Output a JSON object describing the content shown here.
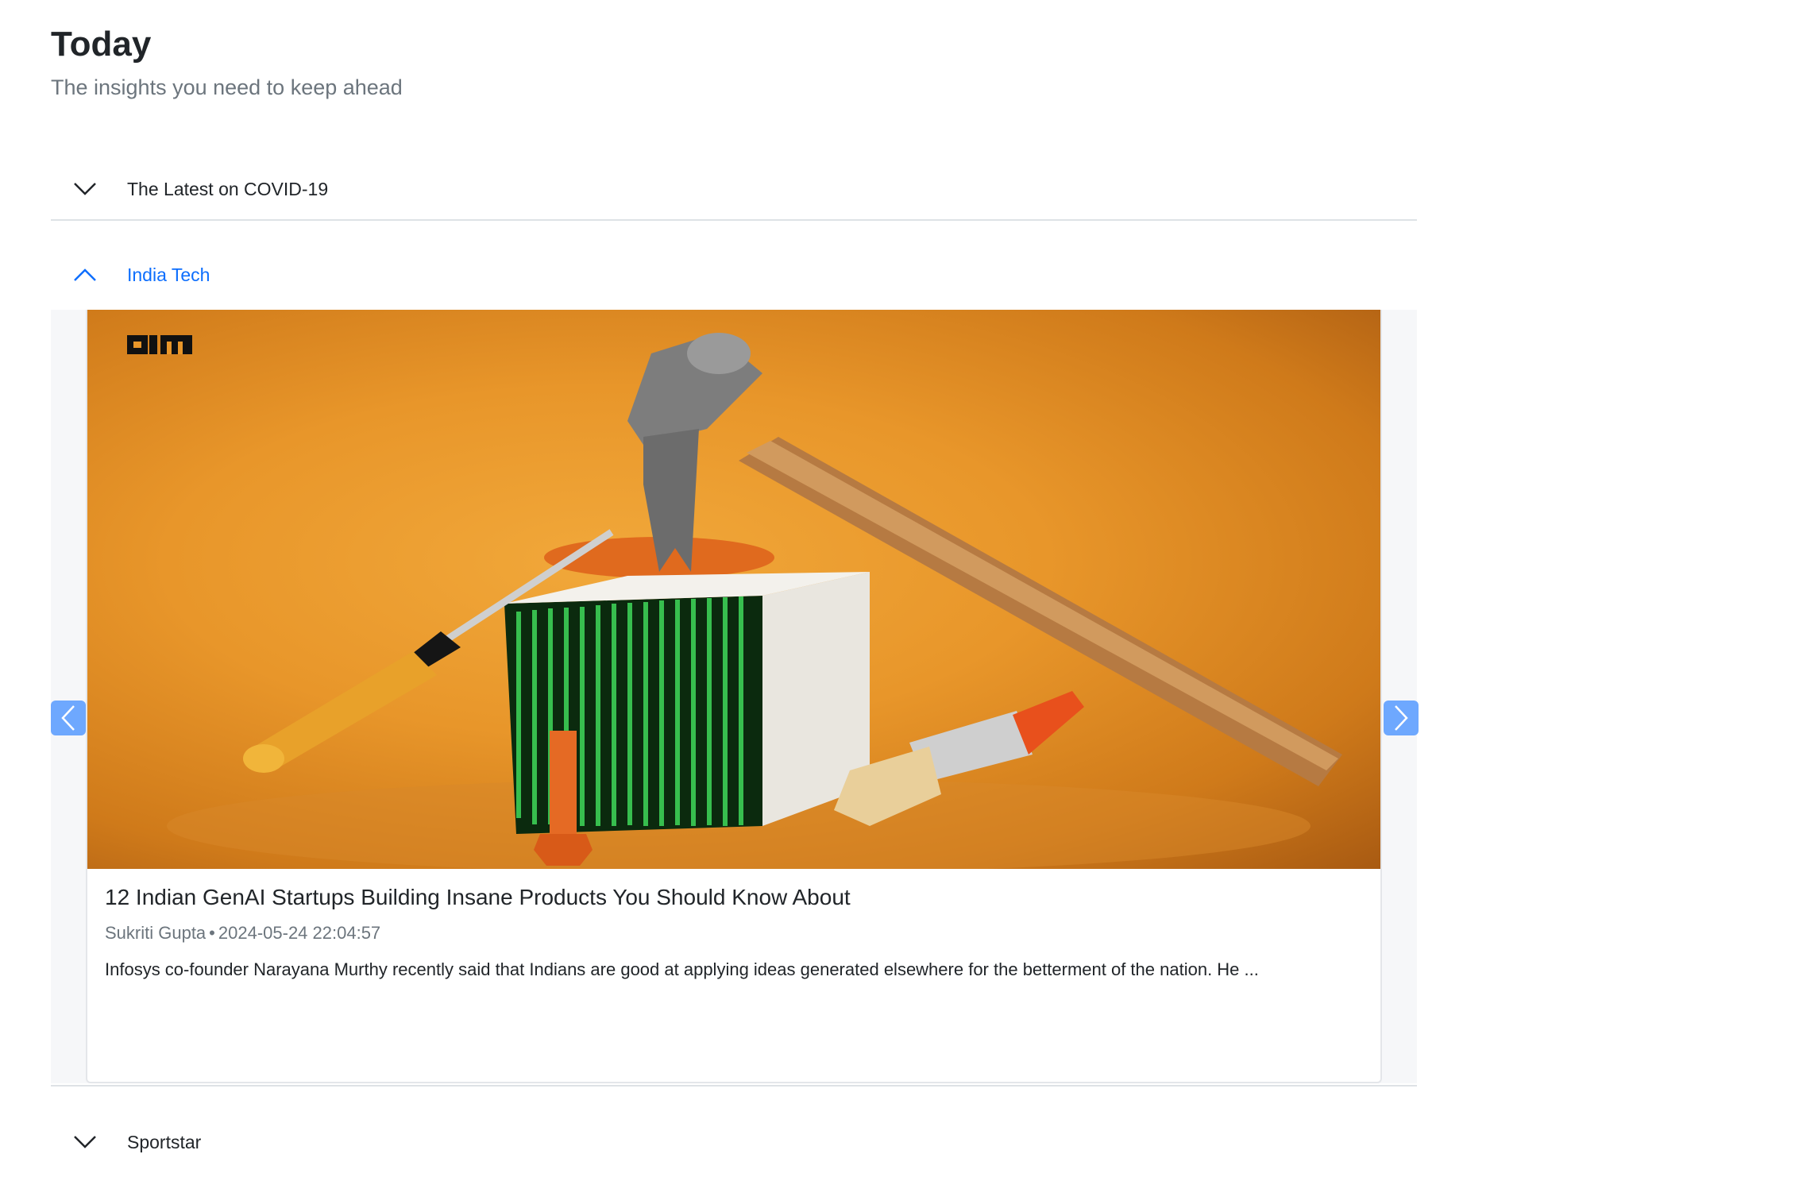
{
  "header": {
    "title": "Today",
    "subtitle": "The insights you need to keep ahead"
  },
  "sections": [
    {
      "label": "The Latest on COVID-19",
      "expanded": false
    },
    {
      "label": "India Tech",
      "expanded": true
    },
    {
      "label": "Sportstar",
      "expanded": false
    }
  ],
  "article": {
    "title": "12 Indian GenAI Startups Building Insane Products You Should Know About",
    "author": "Sukriti Gupta",
    "separator": "•",
    "timestamp": "2024-05-24 22:04:57",
    "excerpt": "Infosys co-founder Narayana Murthy recently said that Indians are good at applying ideas generated elsewhere for the betterment of the nation. He ...",
    "image_logo": "AIM"
  },
  "colors": {
    "accent": "#0d6efd",
    "nav_button": "#6ea8fe",
    "divider": "#dee2e6",
    "muted_text": "#6c757d"
  },
  "icons": {
    "collapsed": "chevron-down-icon",
    "expanded": "chevron-up-icon",
    "prev": "chevron-left-icon",
    "next": "chevron-right-icon"
  }
}
